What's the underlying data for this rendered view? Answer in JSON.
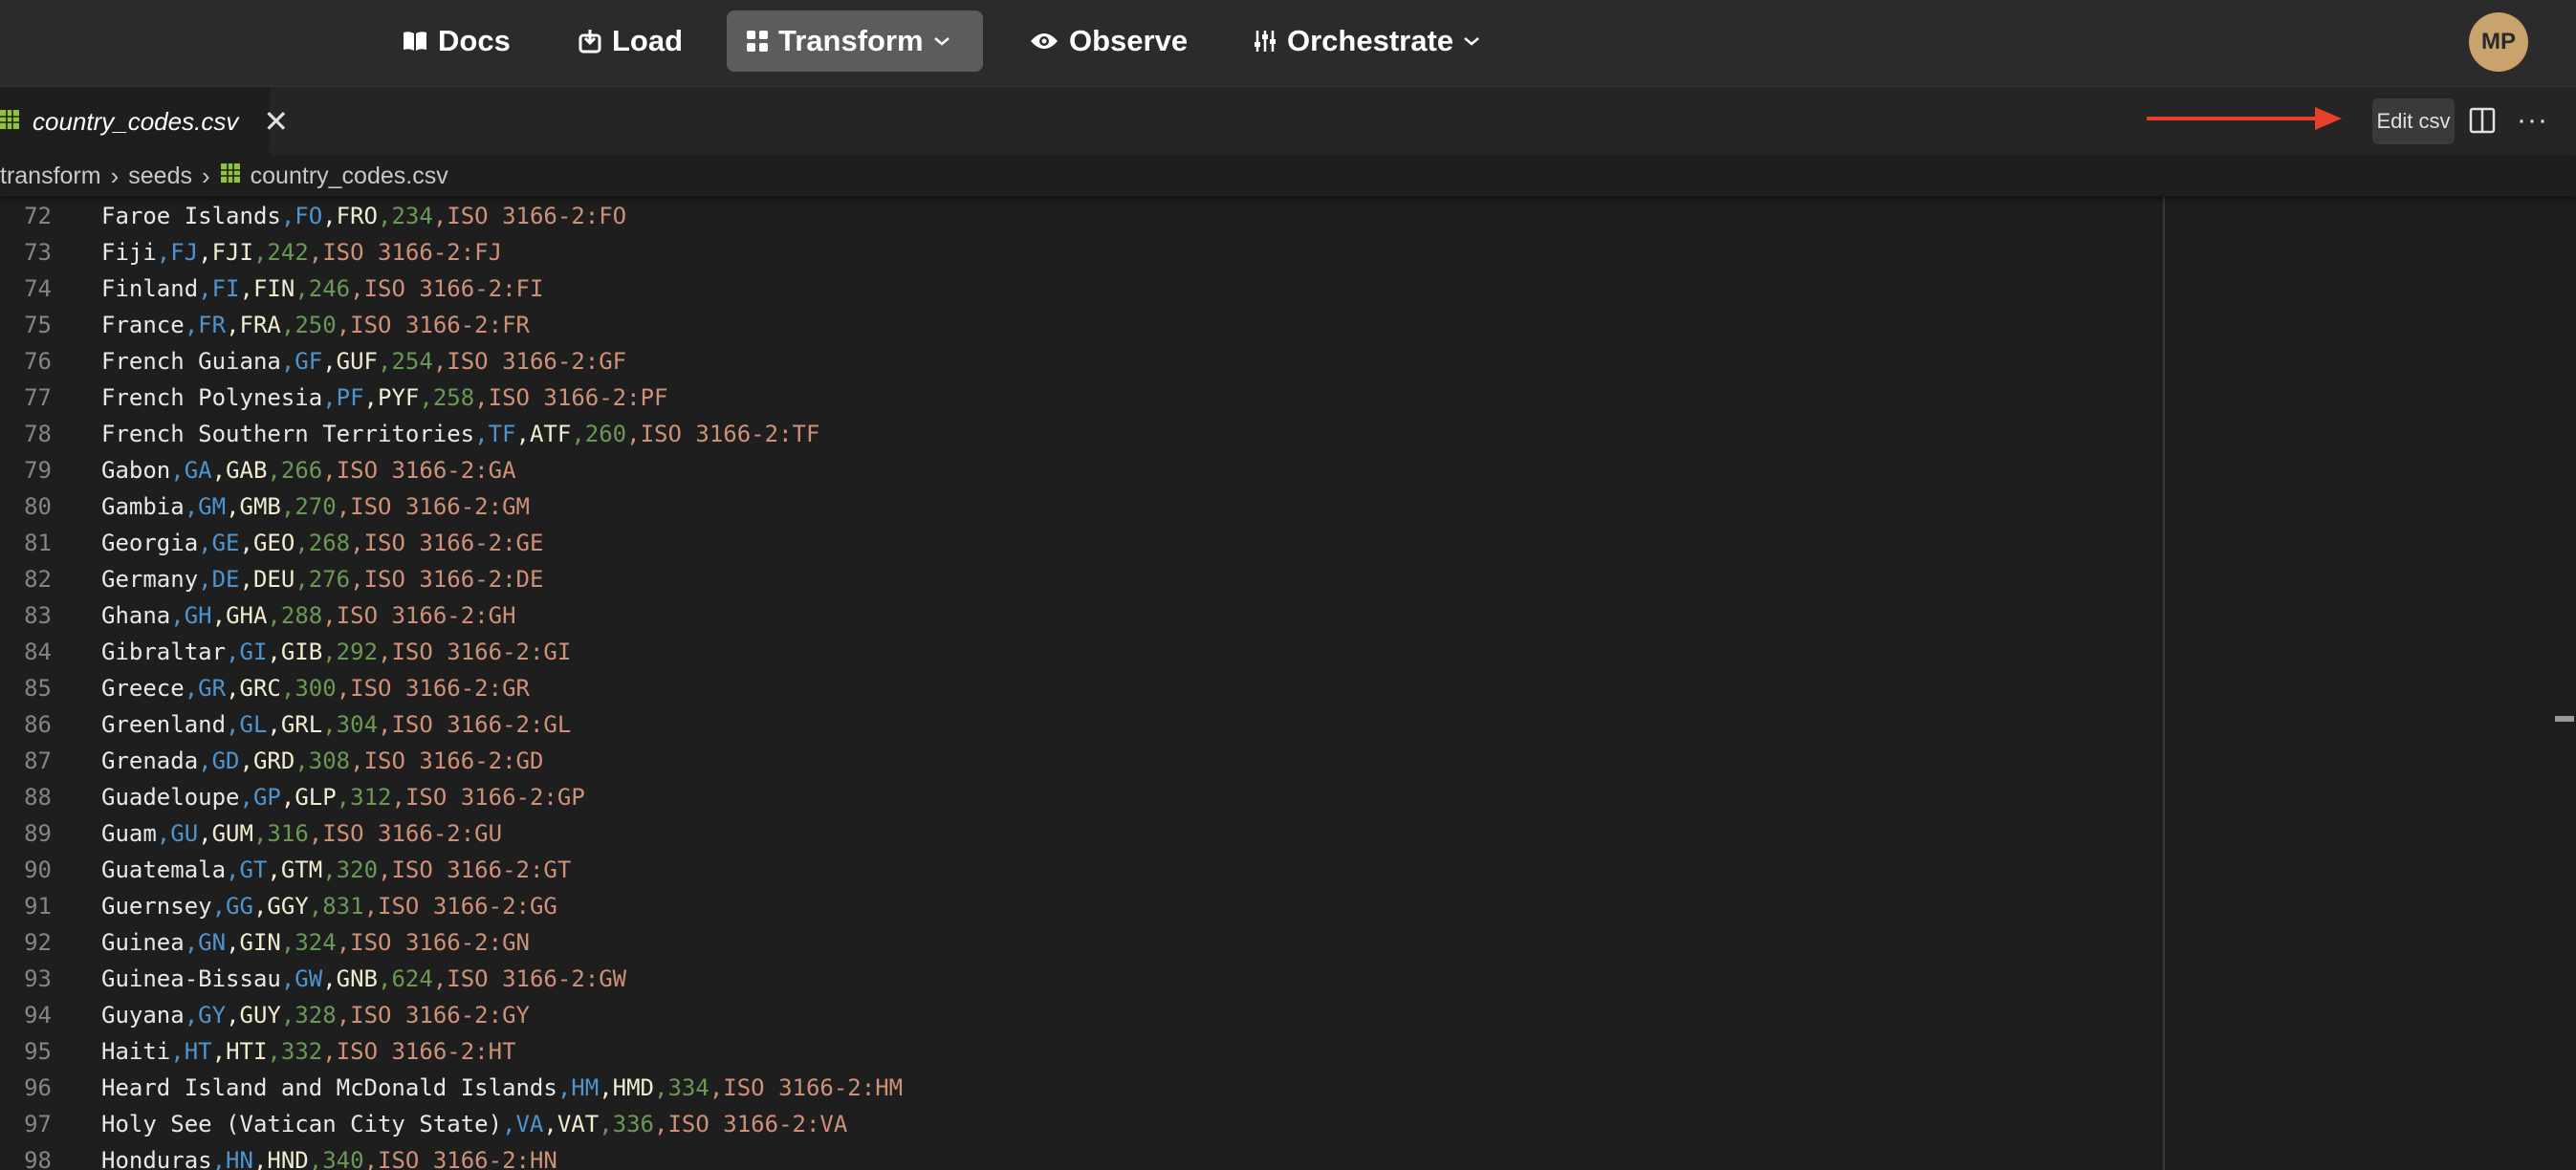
{
  "nav": {
    "items": [
      {
        "label": "Docs",
        "icon": "book-icon"
      },
      {
        "label": "Load",
        "icon": "load-icon"
      },
      {
        "label": "Transform",
        "icon": "transform-icon",
        "active": true,
        "dropdown": true
      },
      {
        "label": "Observe",
        "icon": "eye-icon"
      },
      {
        "label": "Orchestrate",
        "icon": "sliders-icon",
        "dropdown": true
      }
    ],
    "avatar_initials": "MP"
  },
  "tab": {
    "label": "country_codes.csv",
    "close": "✕"
  },
  "toolbar": {
    "edit_csv_label": "Edit csv",
    "more": "···"
  },
  "breadcrumb": {
    "parts": [
      "transform",
      "seeds",
      "country_codes.csv"
    ]
  },
  "colors": {
    "nav_bg": "#2b2b2b",
    "active_nav": "#5c5c5c",
    "editor_bg": "#1e1e1e",
    "csv_icon": "#8fc33a",
    "arrow": "#e8412b",
    "col_name": "#e8e8e8",
    "col_alpha2": "#4e94ce",
    "col_alpha3": "#f0ecd0",
    "col_numeric": "#6a9955",
    "col_iso": "#ce9178"
  },
  "lines": [
    {
      "n": "72",
      "cols": [
        "Faroe Islands",
        "FO",
        "FRO",
        "234",
        "ISO 3166-2:FO"
      ]
    },
    {
      "n": "73",
      "cols": [
        "Fiji",
        "FJ",
        "FJI",
        "242",
        "ISO 3166-2:FJ"
      ]
    },
    {
      "n": "74",
      "cols": [
        "Finland",
        "FI",
        "FIN",
        "246",
        "ISO 3166-2:FI"
      ]
    },
    {
      "n": "75",
      "cols": [
        "France",
        "FR",
        "FRA",
        "250",
        "ISO 3166-2:FR"
      ]
    },
    {
      "n": "76",
      "cols": [
        "French Guiana",
        "GF",
        "GUF",
        "254",
        "ISO 3166-2:GF"
      ]
    },
    {
      "n": "77",
      "cols": [
        "French Polynesia",
        "PF",
        "PYF",
        "258",
        "ISO 3166-2:PF"
      ]
    },
    {
      "n": "78",
      "cols": [
        "French Southern Territories",
        "TF",
        "ATF",
        "260",
        "ISO 3166-2:TF"
      ]
    },
    {
      "n": "79",
      "cols": [
        "Gabon",
        "GA",
        "GAB",
        "266",
        "ISO 3166-2:GA"
      ]
    },
    {
      "n": "80",
      "cols": [
        "Gambia",
        "GM",
        "GMB",
        "270",
        "ISO 3166-2:GM"
      ]
    },
    {
      "n": "81",
      "cols": [
        "Georgia",
        "GE",
        "GEO",
        "268",
        "ISO 3166-2:GE"
      ]
    },
    {
      "n": "82",
      "cols": [
        "Germany",
        "DE",
        "DEU",
        "276",
        "ISO 3166-2:DE"
      ]
    },
    {
      "n": "83",
      "cols": [
        "Ghana",
        "GH",
        "GHA",
        "288",
        "ISO 3166-2:GH"
      ]
    },
    {
      "n": "84",
      "cols": [
        "Gibraltar",
        "GI",
        "GIB",
        "292",
        "ISO 3166-2:GI"
      ]
    },
    {
      "n": "85",
      "cols": [
        "Greece",
        "GR",
        "GRC",
        "300",
        "ISO 3166-2:GR"
      ]
    },
    {
      "n": "86",
      "cols": [
        "Greenland",
        "GL",
        "GRL",
        "304",
        "ISO 3166-2:GL"
      ]
    },
    {
      "n": "87",
      "cols": [
        "Grenada",
        "GD",
        "GRD",
        "308",
        "ISO 3166-2:GD"
      ]
    },
    {
      "n": "88",
      "cols": [
        "Guadeloupe",
        "GP",
        "GLP",
        "312",
        "ISO 3166-2:GP"
      ]
    },
    {
      "n": "89",
      "cols": [
        "Guam",
        "GU",
        "GUM",
        "316",
        "ISO 3166-2:GU"
      ]
    },
    {
      "n": "90",
      "cols": [
        "Guatemala",
        "GT",
        "GTM",
        "320",
        "ISO 3166-2:GT"
      ]
    },
    {
      "n": "91",
      "cols": [
        "Guernsey",
        "GG",
        "GGY",
        "831",
        "ISO 3166-2:GG"
      ]
    },
    {
      "n": "92",
      "cols": [
        "Guinea",
        "GN",
        "GIN",
        "324",
        "ISO 3166-2:GN"
      ]
    },
    {
      "n": "93",
      "cols": [
        "Guinea-Bissau",
        "GW",
        "GNB",
        "624",
        "ISO 3166-2:GW"
      ]
    },
    {
      "n": "94",
      "cols": [
        "Guyana",
        "GY",
        "GUY",
        "328",
        "ISO 3166-2:GY"
      ]
    },
    {
      "n": "95",
      "cols": [
        "Haiti",
        "HT",
        "HTI",
        "332",
        "ISO 3166-2:HT"
      ]
    },
    {
      "n": "96",
      "cols": [
        "Heard Island and McDonald Islands",
        "HM",
        "HMD",
        "334",
        "ISO 3166-2:HM"
      ]
    },
    {
      "n": "97",
      "cols": [
        "Holy See (Vatican City State)",
        "VA",
        "VAT",
        "336",
        "ISO 3166-2:VA"
      ]
    },
    {
      "n": "98",
      "cols": [
        "Honduras",
        "HN",
        "HND",
        "340",
        "ISO 3166-2:HN"
      ]
    }
  ]
}
